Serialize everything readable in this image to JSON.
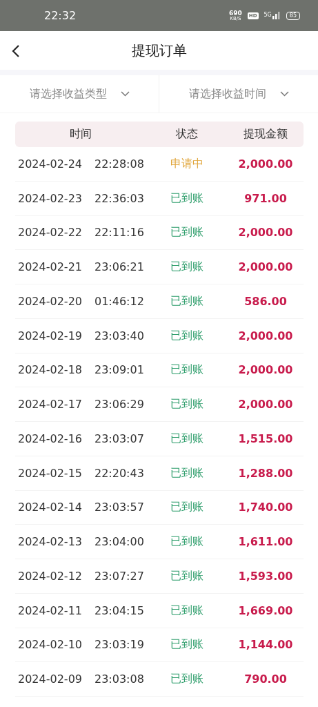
{
  "status_bar": {
    "time": "22:32",
    "speed_value": "690",
    "speed_unit": "KB/S",
    "hd": "HD",
    "network": "5G",
    "battery": "85"
  },
  "header": {
    "title": "提现订单"
  },
  "filters": [
    {
      "placeholder": "请选择收益类型"
    },
    {
      "placeholder": "请选择收益时间"
    }
  ],
  "table": {
    "columns": [
      "时间",
      "状态",
      "提现金额"
    ],
    "rows": [
      {
        "date": "2024-02-24",
        "time": "22:28:08",
        "status": "申请中",
        "kind": "pending",
        "amount": "2,000.00"
      },
      {
        "date": "2024-02-23",
        "time": "22:36:03",
        "status": "已到账",
        "kind": "done",
        "amount": "971.00"
      },
      {
        "date": "2024-02-22",
        "time": "22:11:16",
        "status": "已到账",
        "kind": "done",
        "amount": "2,000.00"
      },
      {
        "date": "2024-02-21",
        "time": "23:06:21",
        "status": "已到账",
        "kind": "done",
        "amount": "2,000.00"
      },
      {
        "date": "2024-02-20",
        "time": "01:46:12",
        "status": "已到账",
        "kind": "done",
        "amount": "586.00"
      },
      {
        "date": "2024-02-19",
        "time": "23:03:40",
        "status": "已到账",
        "kind": "done",
        "amount": "2,000.00"
      },
      {
        "date": "2024-02-18",
        "time": "23:09:01",
        "status": "已到账",
        "kind": "done",
        "amount": "2,000.00"
      },
      {
        "date": "2024-02-17",
        "time": "23:06:29",
        "status": "已到账",
        "kind": "done",
        "amount": "2,000.00"
      },
      {
        "date": "2024-02-16",
        "time": "23:03:07",
        "status": "已到账",
        "kind": "done",
        "amount": "1,515.00"
      },
      {
        "date": "2024-02-15",
        "time": "22:20:43",
        "status": "已到账",
        "kind": "done",
        "amount": "1,288.00"
      },
      {
        "date": "2024-02-14",
        "time": "23:03:57",
        "status": "已到账",
        "kind": "done",
        "amount": "1,740.00"
      },
      {
        "date": "2024-02-13",
        "time": "23:04:00",
        "status": "已到账",
        "kind": "done",
        "amount": "1,611.00"
      },
      {
        "date": "2024-02-12",
        "time": "23:07:27",
        "status": "已到账",
        "kind": "done",
        "amount": "1,593.00"
      },
      {
        "date": "2024-02-11",
        "time": "23:04:15",
        "status": "已到账",
        "kind": "done",
        "amount": "1,669.00"
      },
      {
        "date": "2024-02-10",
        "time": "23:03:19",
        "status": "已到账",
        "kind": "done",
        "amount": "1,144.00"
      },
      {
        "date": "2024-02-09",
        "time": "23:03:08",
        "status": "已到账",
        "kind": "done",
        "amount": "790.00"
      }
    ]
  }
}
